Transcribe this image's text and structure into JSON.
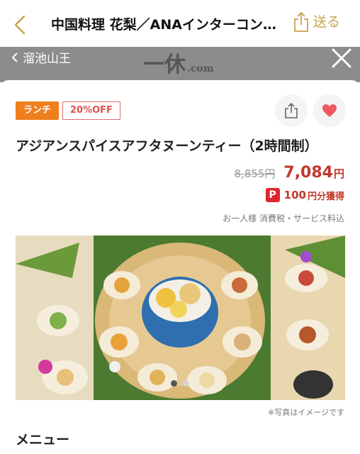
{
  "navbar": {
    "title": "中国料理 花梨／ANAインターコンチネンタルホテル東京",
    "share_label": "送る"
  },
  "background": {
    "back_label": "溜池山王",
    "logo_main": "一休",
    "logo_suffix": ".com"
  },
  "plan": {
    "tags": {
      "lunch": "ランチ",
      "discount": "20%OFF"
    },
    "title": "アジアンスパイスアフタヌーンティー（2時間制）",
    "old_price": "8,855円",
    "new_price": "7,084",
    "yen": "円",
    "points_icon": "P",
    "points_value": "100",
    "points_unit": "円分獲得",
    "tax_note": "お一人様 消費税・サービス料込",
    "photo_note": "※写真はイメージです",
    "carousel": {
      "count": 2,
      "active": 0,
      "active_color": "#555555",
      "inactive_color": "#d4d4d4"
    }
  },
  "sections": {
    "menu_heading": "メニュー"
  },
  "colors": {
    "accent": "#c8a14a",
    "lunch": "#ef7e1c",
    "price": "#c0392b",
    "heart": "#ee5a64"
  }
}
